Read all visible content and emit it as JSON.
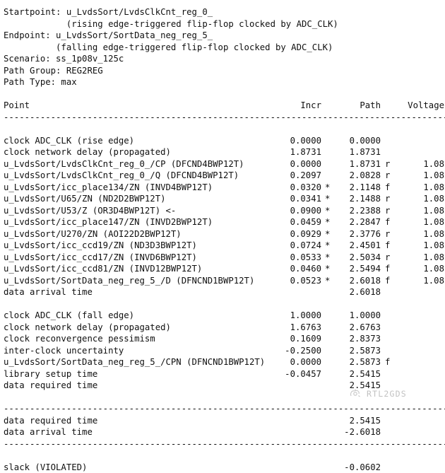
{
  "report": {
    "preamble": [
      "Startpoint: u_LvdsSort/LvdsClkCnt_reg_0_",
      "            (rising edge-triggered flip-flop clocked by ADC_CLK)",
      "Endpoint: u_LvdsSort/SortData_neg_reg_5_",
      "          (falling edge-triggered flip-flop clocked by ADC_CLK)",
      "Scenario: ss_1p08v_125c",
      "Path Group: REG2REG",
      "Path Type: max"
    ],
    "columns": {
      "point": "Point",
      "incr": "Incr",
      "path": "Path",
      "voltage": "Voltage"
    },
    "separator": "--------------------------------------------------------------------------------------",
    "launch_rows": [
      {
        "point": "clock ADC_CLK (rise edge)",
        "incr": "0.0000",
        "star": "",
        "path": "0.0000",
        "edge": "",
        "volt": ""
      },
      {
        "point": "clock network delay (propagated)",
        "incr": "1.8731",
        "star": "",
        "path": "1.8731",
        "edge": "",
        "volt": ""
      },
      {
        "point": "u_LvdsSort/LvdsClkCnt_reg_0_/CP (DFCND4BWP12T)",
        "incr": "0.0000",
        "star": "",
        "path": "1.8731",
        "edge": "r",
        "volt": "1.08"
      },
      {
        "point": "u_LvdsSort/LvdsClkCnt_reg_0_/Q (DFCND4BWP12T)",
        "incr": "0.2097",
        "star": "",
        "path": "2.0828",
        "edge": "r",
        "volt": "1.08"
      },
      {
        "point": "u_LvdsSort/icc_place134/ZN (INVD4BWP12T)",
        "incr": "0.0320",
        "star": "*",
        "path": "2.1148",
        "edge": "f",
        "volt": "1.08"
      },
      {
        "point": "u_LvdsSort/U65/ZN (ND2D2BWP12T)",
        "incr": "0.0341",
        "star": "*",
        "path": "2.1488",
        "edge": "r",
        "volt": "1.08"
      },
      {
        "point": "u_LvdsSort/U53/Z (OR3D4BWP12T) <-",
        "incr": "0.0900",
        "star": "*",
        "path": "2.2388",
        "edge": "r",
        "volt": "1.08"
      },
      {
        "point": "u_LvdsSort/icc_place147/ZN (INVD2BWP12T)",
        "incr": "0.0459",
        "star": "*",
        "path": "2.2847",
        "edge": "f",
        "volt": "1.08"
      },
      {
        "point": "u_LvdsSort/U270/ZN (AOI22D2BWP12T)",
        "incr": "0.0929",
        "star": "*",
        "path": "2.3776",
        "edge": "r",
        "volt": "1.08"
      },
      {
        "point": "u_LvdsSort/icc_ccd19/ZN (ND3D3BWP12T)",
        "incr": "0.0724",
        "star": "*",
        "path": "2.4501",
        "edge": "f",
        "volt": "1.08"
      },
      {
        "point": "u_LvdsSort/icc_ccd17/ZN (INVD6BWP12T)",
        "incr": "0.0533",
        "star": "*",
        "path": "2.5034",
        "edge": "r",
        "volt": "1.08"
      },
      {
        "point": "u_LvdsSort/icc_ccd81/ZN (INVD12BWP12T)",
        "incr": "0.0460",
        "star": "*",
        "path": "2.5494",
        "edge": "f",
        "volt": "1.08"
      },
      {
        "point": "u_LvdsSort/SortData_neg_reg_5_/D (DFNCND1BWP12T)",
        "incr": "0.0523",
        "star": "*",
        "path": "2.6018",
        "edge": "f",
        "volt": "1.08"
      },
      {
        "point": "data arrival time",
        "incr": "",
        "star": "",
        "path": "2.6018",
        "edge": "",
        "volt": ""
      }
    ],
    "capture_rows": [
      {
        "point": "clock ADC_CLK (fall edge)",
        "incr": "1.0000",
        "star": "",
        "path": "1.0000",
        "edge": "",
        "volt": ""
      },
      {
        "point": "clock network delay (propagated)",
        "incr": "1.6763",
        "star": "",
        "path": "2.6763",
        "edge": "",
        "volt": ""
      },
      {
        "point": "clock reconvergence pessimism",
        "incr": "0.1609",
        "star": "",
        "path": "2.8373",
        "edge": "",
        "volt": ""
      },
      {
        "point": "inter-clock uncertainty",
        "incr": "-0.2500",
        "star": "",
        "path": "2.5873",
        "edge": "",
        "volt": ""
      },
      {
        "point": "u_LvdsSort/SortData_neg_reg_5_/CPN (DFNCND1BWP12T)",
        "incr": "0.0000",
        "star": "",
        "path": "2.5873",
        "edge": "f",
        "volt": ""
      },
      {
        "point": "library setup time",
        "incr": "-0.0457",
        "star": "",
        "path": "2.5415",
        "edge": "",
        "volt": ""
      },
      {
        "point": "data required time",
        "incr": "",
        "star": "",
        "path": "2.5415",
        "edge": "",
        "volt": ""
      }
    ],
    "summary_rows": [
      {
        "point": "data required time",
        "incr": "",
        "star": "",
        "path": "2.5415",
        "edge": "",
        "volt": ""
      },
      {
        "point": "data arrival time",
        "incr": "",
        "star": "",
        "path": "-2.6018",
        "edge": "",
        "volt": ""
      }
    ],
    "slack_row": {
      "point": "slack (VIOLATED)",
      "incr": "",
      "star": "",
      "path": "-0.0602",
      "edge": "",
      "volt": ""
    }
  },
  "watermark": {
    "text": "RTL2GDS"
  }
}
